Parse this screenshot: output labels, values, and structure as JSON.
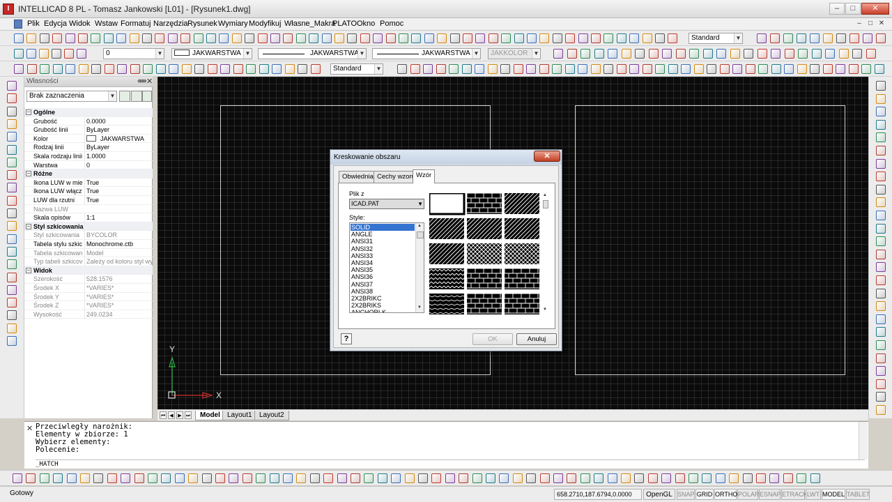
{
  "window": {
    "title": "INTELLICAD 8 PL - Tomasz Jankowski [L01] - [Rysunek1.dwg]",
    "app_icon": "intellicad-logo-icon",
    "minimize": "–",
    "maximize": "□",
    "close": "✕"
  },
  "menu": {
    "items": [
      "Plik",
      "Edycja",
      "Widok",
      "Wstaw",
      "Formatuj",
      "Narzędzia",
      "Rysunek",
      "Wymiary",
      "Modyfikuj",
      "Własne_Makra",
      "PLATO",
      "Okno",
      "Pomoc"
    ]
  },
  "toolbars": {
    "textstyle_combo": "Standard",
    "layer_combo": "0",
    "linetype_combo": "JAKWARSTWA",
    "lineweight_combo": "JAKWARSTWA",
    "plotstyle_combo": "JAKWARSTWA",
    "color_combo": "JAKKOLOR",
    "dimstyle_combo": "Standard"
  },
  "properties": {
    "title": "Własności",
    "pin": "ᚔ",
    "close": "✕",
    "selection": "Brak zaznaczenia",
    "rows": [
      {
        "type": "cat",
        "name": "Ogólne",
        "toggle": "−"
      },
      {
        "name": "Grubość",
        "value": "0.0000"
      },
      {
        "name": "Grubość linii",
        "value": "ByLayer"
      },
      {
        "name": "Kolor",
        "value": "JAKWARSTWA",
        "swatch": true
      },
      {
        "name": "Rodzaj linii",
        "value": "ByLayer"
      },
      {
        "name": "Skala rodzaju linii",
        "value": "1.0000"
      },
      {
        "name": "Warstwa",
        "value": "0"
      },
      {
        "type": "cat",
        "name": "Różne",
        "toggle": "−"
      },
      {
        "name": "Ikona LUW w mie",
        "value": "True"
      },
      {
        "name": "Ikona LUW włącz",
        "value": "True"
      },
      {
        "name": "LUW dla rzutni",
        "value": "True"
      },
      {
        "name": "Nazwa LUW",
        "value": "",
        "dim": true
      },
      {
        "name": "Skala opisów",
        "value": "1:1"
      },
      {
        "type": "cat",
        "name": "Styl szkicowania",
        "toggle": "−"
      },
      {
        "name": "Styl szkicowania",
        "value": "BYCOLOR",
        "dim": true
      },
      {
        "name": "Tabela stylu szkic",
        "value": "Monochrome.ctb"
      },
      {
        "name": "Tabela szkicowan",
        "value": "Model",
        "dim": true
      },
      {
        "name": "Typ tabeli szkicov",
        "value": "Zależy od koloru styl wyd",
        "dim": true
      },
      {
        "type": "cat",
        "name": "Widok",
        "toggle": "−"
      },
      {
        "name": "Szerokość",
        "value": "528.1576",
        "dim": true
      },
      {
        "name": "Środek X",
        "value": "*VARIES*",
        "dim": true
      },
      {
        "name": "Środek Y",
        "value": "*VARIES*",
        "dim": true
      },
      {
        "name": "Środek Z",
        "value": "*VARIES*",
        "dim": true
      },
      {
        "name": "Wysokość",
        "value": "249.0234",
        "dim": true
      }
    ]
  },
  "canvas": {
    "ucs_y": "Y",
    "ucs_x": "X"
  },
  "layout_tabs": {
    "nav": [
      "⏮",
      "◀",
      "▶",
      "⏭"
    ],
    "tabs": [
      "Model",
      "Layout1",
      "Layout2"
    ],
    "active": "Model"
  },
  "command": {
    "close": "✕",
    "history": [
      "Przeciwległy narożnik:",
      "Elementy w zbiorze: 1",
      "Wybierz elementy:",
      "Polecenie:"
    ],
    "input": "_HATCH"
  },
  "dialog": {
    "title": "Kreskowanie obszaru",
    "close": "✕",
    "tabs": [
      "Obwiednia",
      "Cechy wzoru",
      "Wzór"
    ],
    "active_tab": "Wzór",
    "file_label": "Plik z",
    "file_value": "ICAD.PAT",
    "style_label": "Style:",
    "styles": [
      "SOLID",
      "ANGLE",
      "ANSI31",
      "ANSI32",
      "ANSI33",
      "ANSI34",
      "ANSI35",
      "ANSI36",
      "ANSI37",
      "ANSI38",
      "2X2BRIKC",
      "2X2BRIKS",
      "ANCHORLK"
    ],
    "selected_style": "SOLID",
    "help": "?",
    "ok": "OK",
    "cancel": "Anuluj"
  },
  "status": {
    "text": "Gotowy",
    "coords": "658.2710,187.6794,0.0000",
    "opengl": "OpenGL",
    "buttons": [
      {
        "label": "SNAP",
        "on": false
      },
      {
        "label": "GRID",
        "on": true
      },
      {
        "label": "ORTHO",
        "on": true
      },
      {
        "label": "POLAR",
        "on": false
      },
      {
        "label": "ESNAP",
        "on": false
      },
      {
        "label": "ETRACK",
        "on": false
      },
      {
        "label": "LWT",
        "on": false
      },
      {
        "label": "MODEL",
        "on": true
      },
      {
        "label": "TABLET",
        "on": false
      }
    ]
  },
  "colors": {
    "canvas": "#0b0b0b",
    "accent": "#3574d0"
  }
}
